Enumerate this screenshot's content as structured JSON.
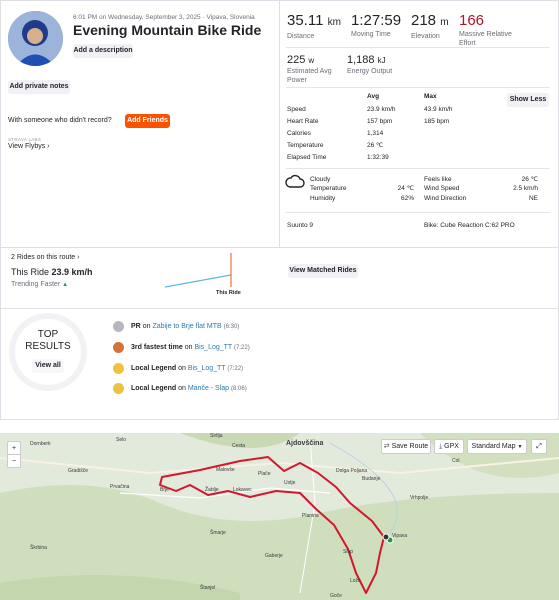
{
  "header": {
    "datetime_location": "6:01 PM on Wednesday, September 3, 2025 · Vipava, Slovenia",
    "title": "Evening Mountain Bike Ride",
    "add_description": "Add a description",
    "add_private_notes": "Add private notes",
    "record_prompt": "With someone who didn't record?",
    "add_friends": "Add Friends",
    "labs_label": "STRAVA LABS",
    "view_flybys": "View Flybys"
  },
  "stats_primary": [
    {
      "value": "35.11",
      "unit": "km",
      "label": "Distance"
    },
    {
      "value": "1:27:59",
      "unit": "",
      "label": "Moving Time"
    },
    {
      "value": "218",
      "unit": "m",
      "label": "Elevation"
    },
    {
      "value": "166",
      "unit": "",
      "label": "Massive Relative Effort"
    }
  ],
  "stats_secondary": [
    {
      "value": "225",
      "unit": "w",
      "label": "Estimated Avg Power"
    },
    {
      "value": "1,188",
      "unit": "kJ",
      "label": "Energy Output"
    }
  ],
  "detail_table": {
    "col_avg": "Avg",
    "col_max": "Max",
    "show_less": "Show Less",
    "rows": [
      {
        "label": "Speed",
        "avg": "23.9 km/h",
        "max": "43.9 km/h"
      },
      {
        "label": "Heart Rate",
        "avg": "157 bpm",
        "max": "185 bpm"
      },
      {
        "label": "Calories",
        "avg": "1,314",
        "max": ""
      },
      {
        "label": "Temperature",
        "avg": "26 ℃",
        "max": ""
      },
      {
        "label": "Elapsed Time",
        "avg": "1:32:39",
        "max": ""
      }
    ]
  },
  "weather": {
    "condition": "Cloudy",
    "temp_label": "Temperature",
    "temp_value": "24 ℃",
    "humidity_label": "Humidity",
    "humidity_value": "62%",
    "feels_label": "Feels like",
    "feels_value": "26 ℃",
    "wind_label": "Wind Speed",
    "wind_value": "2.5 km/h",
    "dir_label": "Wind Direction",
    "dir_value": "NE"
  },
  "device": "Suunto 9",
  "bike": "Bike: Cube Reaction C:62 PRO",
  "matched": {
    "count": "2 Rides on this route",
    "this_ride_label": "This Ride",
    "this_ride_value": "23.9 km/h",
    "trend": "Trending Faster",
    "chart_label": "This Ride",
    "view_button": "View Matched Rides"
  },
  "results": {
    "title_line1": "TOP",
    "title_line2": "RESULTS",
    "view_all": "View all",
    "items": [
      {
        "badge": "PR",
        "on": "on",
        "segment": "Zabije to Brje flat MTB",
        "time": "(6:30)",
        "color": "#9a9aa2"
      },
      {
        "badge": "3rd fastest time",
        "on": "on",
        "segment": "Bis_Log_TT",
        "time": "(7:22)",
        "color": "#c8692a"
      },
      {
        "badge": "Local Legend",
        "on": "on",
        "segment": "Bis_Log_TT",
        "time": "(7:22)",
        "color": "#e8b52b"
      },
      {
        "badge": "Local Legend",
        "on": "on",
        "segment": "Manče - Slap",
        "time": "(8:06)",
        "color": "#e8b52b"
      }
    ]
  },
  "map": {
    "zoom_in": "+",
    "zoom_out": "−",
    "save_route": "Save Route",
    "gpx": "GPX",
    "map_type": "Standard Map",
    "towns": [
      "Dornberk",
      "Selo",
      "Sirtlja",
      "Cesta",
      "Ajdovščina",
      "Col",
      "Gradišče",
      "Malovše",
      "Plače",
      "Dolga Poljana",
      "Budanje",
      "Prvačina",
      "Brje",
      "Žablje",
      "Lokavec",
      "Ustje",
      "Vrhpolje",
      "Planina",
      "Šmarje",
      "Slap",
      "Gaberje",
      "Škrbina",
      "Vipava",
      "Lože",
      "Goče",
      "Štanjel"
    ],
    "colors": {
      "route": "#d3172e",
      "land": "#dfe8d2",
      "forest": "#c9dbb6"
    }
  }
}
